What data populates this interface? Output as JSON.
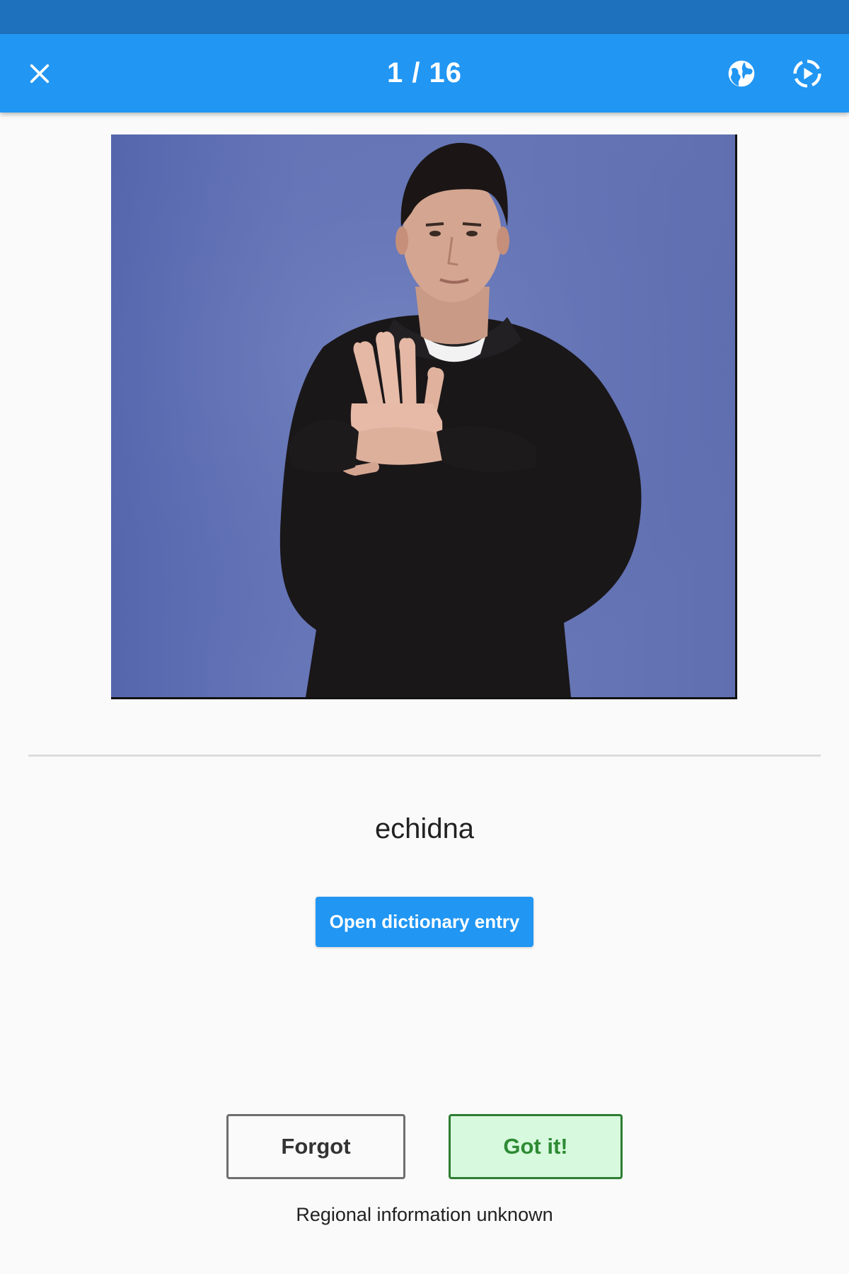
{
  "header": {
    "counter": "1 / 16",
    "close_icon": "close-icon",
    "region_icon": "globe-icon",
    "autoplay_icon": "autoplay-icon"
  },
  "video": {
    "content": "signer-demonstrating-sign",
    "background_color": "#6372b5"
  },
  "card": {
    "word": "echidna",
    "dictionary_button": "Open dictionary entry"
  },
  "actions": {
    "forgot_label": "Forgot",
    "got_it_label": "Got it!"
  },
  "footer": {
    "regional_info": "Regional information unknown"
  },
  "colors": {
    "accent": "#2196f3",
    "status_bar": "#1e72bd",
    "got_it_border": "#2e7d32",
    "got_it_bg": "#d7f9de"
  }
}
